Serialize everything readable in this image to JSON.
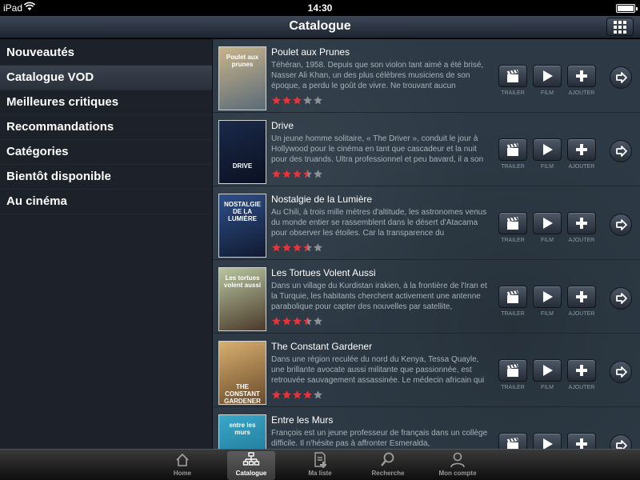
{
  "status": {
    "carrier": "iPad",
    "time": "14:30"
  },
  "navbar": {
    "title": "Catalogue",
    "grid_icon": "grid-icon"
  },
  "sidebar": {
    "items": [
      {
        "label": "Nouveautés",
        "active": false
      },
      {
        "label": "Catalogue VOD",
        "active": true
      },
      {
        "label": "Meilleures critiques",
        "active": false
      },
      {
        "label": "Recommandations",
        "active": false
      },
      {
        "label": "Catégories",
        "active": false
      },
      {
        "label": "Bientôt disponible",
        "active": false
      },
      {
        "label": "Au cinéma",
        "active": false
      }
    ]
  },
  "action_labels": {
    "trailer": "TRAILER",
    "film": "FILM",
    "add": "AJOUTER"
  },
  "films": [
    {
      "title": "Poulet aux Prunes",
      "synopsis": "Téhéran, 1958. Depuis que son violon tant aimé a été brisé, Nasser Ali Khan, un des plus célèbres musiciens de son époque, a perdu le goût de vivre. Ne trouvant aucun",
      "rating": 3,
      "poster_text": "Poulet aux prunes",
      "poster_colors": [
        "#c8b48a",
        "#5a6a78"
      ]
    },
    {
      "title": "Drive",
      "synopsis": "Un jeune homme solitaire, « The Driver », conduit le jour à Hollywood pour le cinéma en tant que cascadeur et la nuit pour des truands. Ultra professionnel et peu bavard, il a son",
      "rating": 3.5,
      "poster_text": "DRIVE",
      "poster_colors": [
        "#1b2a4a",
        "#0a1020"
      ]
    },
    {
      "title": "Nostalgie de la Lumière",
      "synopsis": "Au Chili, à trois mille mètres d'altitude, les astronomes venus du monde entier se rassemblent dans le désert d'Atacama pour observer les étoiles. Car la transparence du",
      "rating": 3.5,
      "poster_text": "NOSTALGIE DE LA LUMIÈRE",
      "poster_colors": [
        "#2f4f8a",
        "#101a30"
      ]
    },
    {
      "title": "Les Tortues Volent Aussi",
      "synopsis": "Dans un village du Kurdistan irakien, à la frontière de l'Iran et la Turquie, les habitants cherchent activement une antenne parabolique pour capter des nouvelles par satellite,",
      "rating": 3.5,
      "poster_text": "Les tortues volent aussi",
      "poster_colors": [
        "#b8c6a0",
        "#4a3a2a"
      ]
    },
    {
      "title": "The Constant Gardener",
      "synopsis": "Dans une région reculée du nord du Kenya, Tessa Quayle, une brillante avocate aussi militante que passionnée, est retrouvée sauvagement assassinée. Le médecin africain qui",
      "rating": 4,
      "poster_text": "THE CONSTANT GARDENER",
      "poster_colors": [
        "#d8b070",
        "#6a4a2a"
      ]
    },
    {
      "title": "Entre les Murs",
      "synopsis": "François est un jeune professeur de français dans un collège difficile. Il n'hésite pas à affronter Esmeralda,",
      "rating": 3.5,
      "poster_text": "entre les murs",
      "poster_colors": [
        "#3aa8c8",
        "#1a6a8a"
      ]
    }
  ],
  "tabbar": {
    "items": [
      {
        "label": "Home",
        "icon": "home-icon",
        "active": false
      },
      {
        "label": "Catalogue",
        "icon": "sitemap-icon",
        "active": true
      },
      {
        "label": "Ma liste",
        "icon": "list-add-icon",
        "active": false
      },
      {
        "label": "Recherche",
        "icon": "search-icon",
        "active": false
      },
      {
        "label": "Mon compte",
        "icon": "user-icon",
        "active": false
      }
    ]
  },
  "colors": {
    "star_on": "#e8333a",
    "star_off": "#8a9096",
    "active_tab": "#ffffff"
  }
}
